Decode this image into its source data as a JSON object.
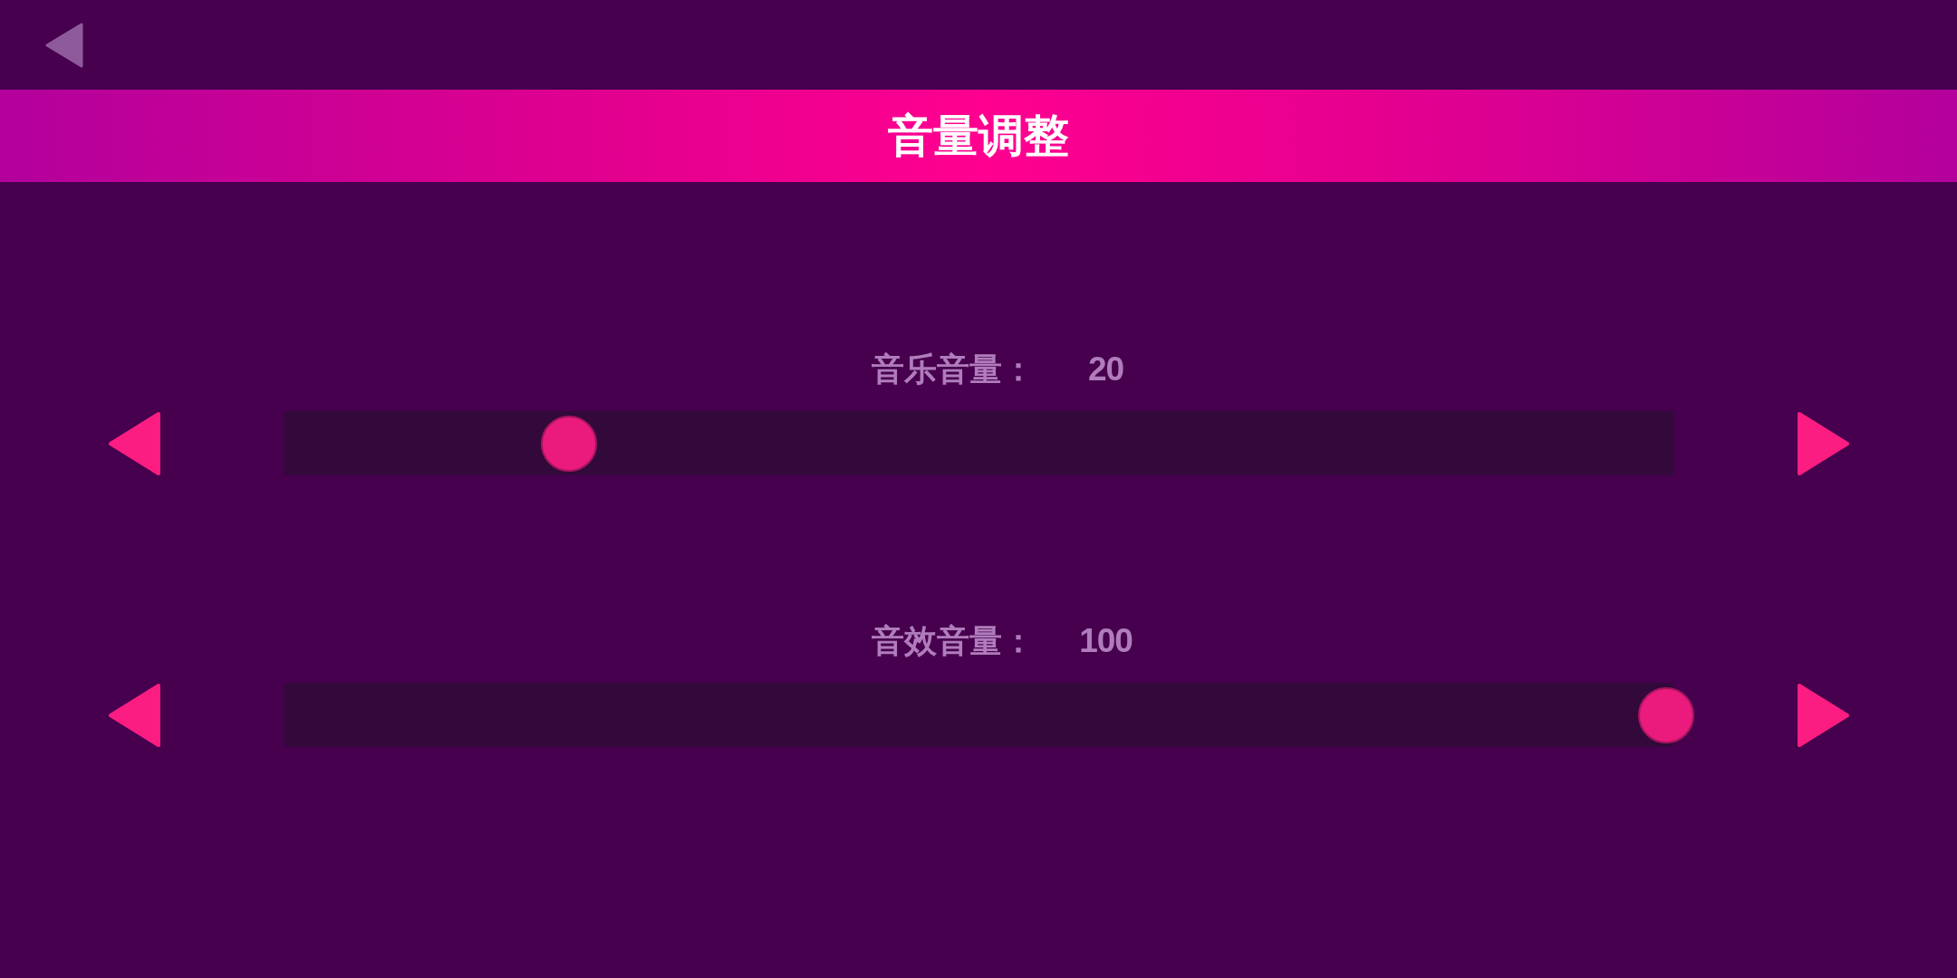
{
  "title": "音量调整",
  "sliders": [
    {
      "label": "音乐音量：",
      "value": "20",
      "level": 0.2
    },
    {
      "label": "音效音量：",
      "value": "100",
      "level": 1
    }
  ]
}
